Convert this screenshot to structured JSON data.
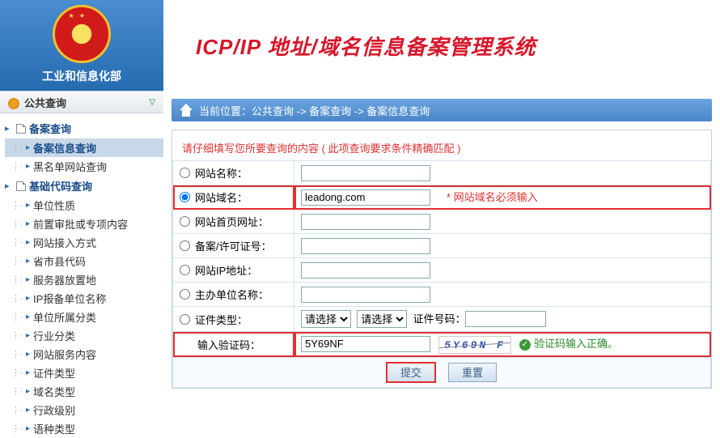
{
  "header": {
    "ministry": "工业和信息化部",
    "system_title": "ICP/IP 地址/域名信息备案管理系统"
  },
  "sidebar": {
    "section_title": "公共查询",
    "groups": [
      {
        "label": "备案查询",
        "items": [
          {
            "label": "备案信息查询",
            "selected": true
          },
          {
            "label": "黑名单网站查询"
          }
        ]
      },
      {
        "label": "基础代码查询",
        "items": [
          {
            "label": "单位性质"
          },
          {
            "label": "前置审批或专项内容"
          },
          {
            "label": "网站接入方式"
          },
          {
            "label": "省市县代码"
          },
          {
            "label": "服务器放置地"
          },
          {
            "label": "IP报备单位名称"
          },
          {
            "label": "单位所属分类"
          },
          {
            "label": "行业分类"
          },
          {
            "label": "网站服务内容"
          },
          {
            "label": "证件类型"
          },
          {
            "label": "域名类型"
          },
          {
            "label": "行政级别"
          },
          {
            "label": "语种类型"
          }
        ]
      }
    ]
  },
  "breadcrumb": {
    "prefix": "当前位置：",
    "parts": [
      "公共查询",
      "备案查询",
      "备案信息查询"
    ],
    "sep": " -> "
  },
  "form": {
    "hint": "请仔细填写您所要查询的内容 ( 此项查询要求条件精确匹配 )",
    "rows": [
      {
        "key": "site_name",
        "label": "网站名称："
      },
      {
        "key": "site_domain",
        "label": "网站域名：",
        "value": "leadong.com",
        "highlight": true,
        "required_note": "* 网站域名必须输入"
      },
      {
        "key": "homepage",
        "label": "网站首页网址："
      },
      {
        "key": "license_no",
        "label": "备案/许可证号："
      },
      {
        "key": "site_ip",
        "label": "网站IP地址："
      },
      {
        "key": "sponsor",
        "label": "主办单位名称："
      }
    ],
    "cert_row": {
      "label": "证件类型：",
      "select1_placeholder": "请选择",
      "select2_placeholder": "请选择",
      "cert_no_label": "证件号码："
    },
    "captcha_row": {
      "label": "输入验证码：",
      "value": "5Y69NF",
      "captcha_image_text": "5Y69N F",
      "ok_text": "验证码输入正确。",
      "highlight": true
    },
    "buttons": {
      "submit": "提交",
      "reset": "重置"
    }
  }
}
